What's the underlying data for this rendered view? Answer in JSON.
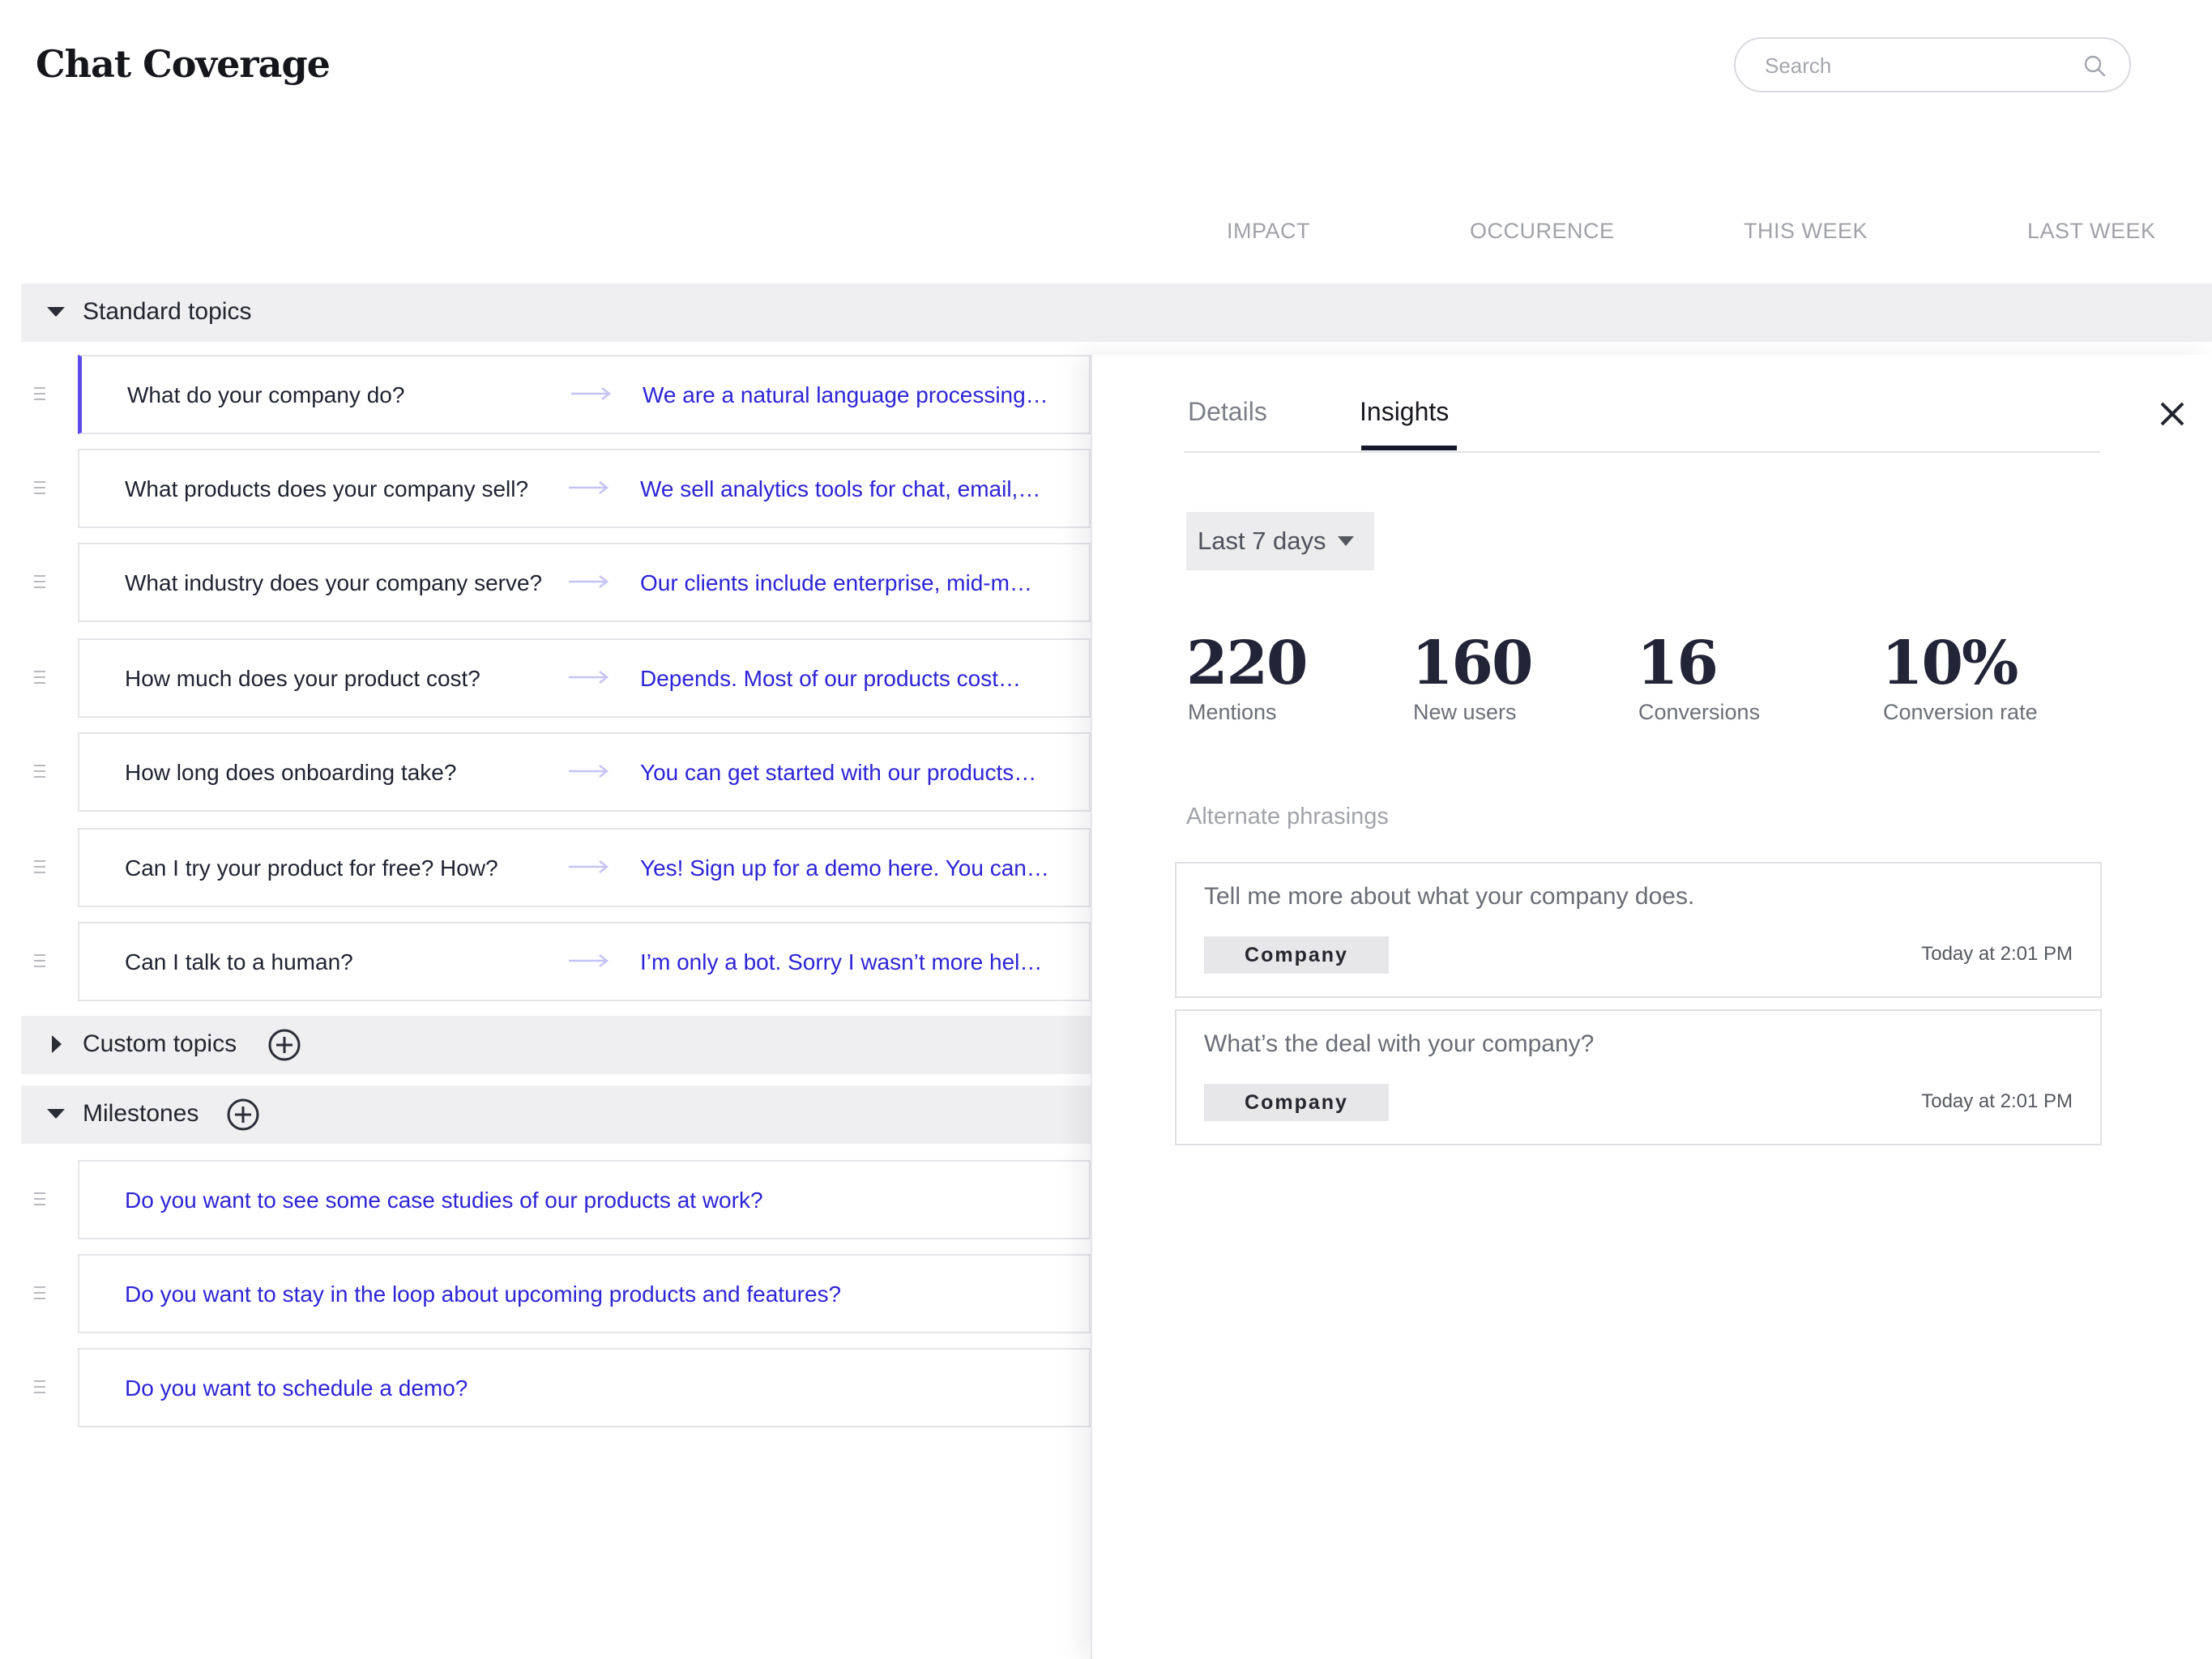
{
  "header": {
    "title": "Chat Coverage",
    "search_placeholder": "Search"
  },
  "columns": [
    "IMPACT",
    "OCCURENCE",
    "THIS WEEK",
    "LAST WEEK"
  ],
  "sections": {
    "standard": {
      "label": "Standard topics",
      "rows": [
        {
          "question": "What do your company do?",
          "answer": "We are a natural language processing…"
        },
        {
          "question": "What products does your company sell?",
          "answer": "We sell analytics tools for chat, email,…"
        },
        {
          "question": "What industry does your company serve?",
          "answer": "Our clients include enterprise, mid-m…"
        },
        {
          "question": "How much does your product cost?",
          "answer": "Depends. Most of our products cost…"
        },
        {
          "question": "How long does onboarding take?",
          "answer": "You can get started with our products…"
        },
        {
          "question": "Can I try your product for free? How?",
          "answer": "Yes! Sign up for a demo here. You can…"
        },
        {
          "question": "Can I talk to a human?",
          "answer": "I’m only a bot. Sorry I wasn’t more hel…"
        }
      ]
    },
    "custom": {
      "label": "Custom topics"
    },
    "milestones": {
      "label": "Milestones",
      "rows": [
        "Do you want to see some case studies of our products at work?",
        "Do you want to stay in the loop about upcoming products and features?",
        "Do you want to schedule a demo?"
      ]
    }
  },
  "panel": {
    "tabs": [
      "Details",
      "Insights"
    ],
    "active_tab": "Insights",
    "range": "Last 7 days",
    "stats": [
      {
        "value": "220",
        "label": "Mentions"
      },
      {
        "value": "160",
        "label": "New users"
      },
      {
        "value": "16",
        "label": "Conversions"
      },
      {
        "value": "10%",
        "label": "Conversion rate"
      }
    ],
    "alt_heading": "Alternate phrasings",
    "phrasings": [
      {
        "text": "Tell me more about what your company does.",
        "tag": "Company",
        "time": "Today at 2:01 PM"
      },
      {
        "text": "What’s the deal with your company?",
        "tag": "Company",
        "time": "Today at 2:01 PM"
      }
    ]
  }
}
